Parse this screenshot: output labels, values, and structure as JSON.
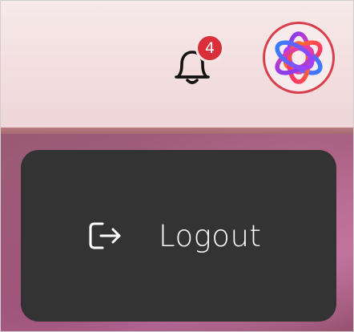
{
  "header": {
    "notifications": {
      "icon": "bell-icon",
      "badge_count": "4"
    },
    "avatar": {
      "icon": "flower-logo-icon"
    }
  },
  "menu": {
    "logout": {
      "icon": "logout-icon",
      "label": "Logout"
    }
  },
  "colors": {
    "badge": "#d92f3a",
    "avatar_ring": "#d9404b",
    "menu_bg": "#333333",
    "header_bg": "#f3dede"
  }
}
